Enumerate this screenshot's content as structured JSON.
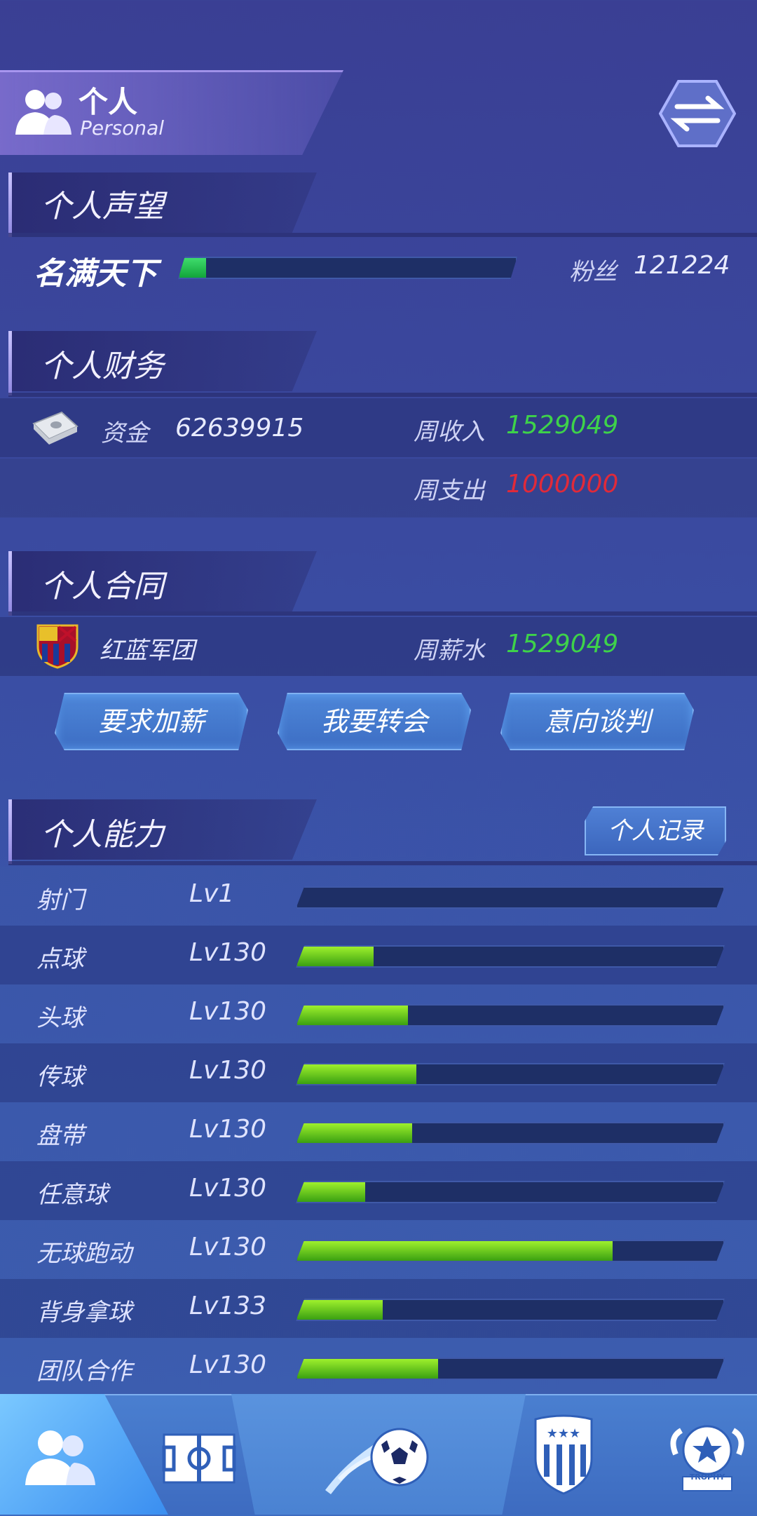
{
  "header": {
    "title": "个人",
    "subtitle": "Personal"
  },
  "reputation": {
    "section_title": "个人声望",
    "rank_title": "名满天下",
    "progress": 0.08,
    "fans_label": "粉丝",
    "fans_value": "121224"
  },
  "finance": {
    "section_title": "个人财务",
    "funds_label": "资金",
    "funds_value": "62639915",
    "weekly_income_label": "周收入",
    "weekly_income_value": "1529049",
    "weekly_expense_label": "周支出",
    "weekly_expense_value": "1000000"
  },
  "contract": {
    "section_title": "个人合同",
    "club_name": "红蓝军团",
    "weekly_salary_label": "周薪水",
    "weekly_salary_value": "1529049",
    "buttons": {
      "raise": "要求加薪",
      "transfer": "我要转会",
      "negotiate": "意向谈判"
    }
  },
  "ability": {
    "section_title": "个人能力",
    "records_button": "个人记录",
    "skills": [
      {
        "name": "射门",
        "level": "Lv1",
        "progress": 0.0
      },
      {
        "name": "点球",
        "level": "Lv130",
        "progress": 0.18
      },
      {
        "name": "头球",
        "level": "Lv130",
        "progress": 0.26
      },
      {
        "name": "传球",
        "level": "Lv130",
        "progress": 0.28
      },
      {
        "name": "盘带",
        "level": "Lv130",
        "progress": 0.27
      },
      {
        "name": "任意球",
        "level": "Lv130",
        "progress": 0.16
      },
      {
        "name": "无球跑动",
        "level": "Lv130",
        "progress": 0.74
      },
      {
        "name": "背身拿球",
        "level": "Lv133",
        "progress": 0.2
      },
      {
        "name": "团队合作",
        "level": "Lv130",
        "progress": 0.33
      }
    ]
  },
  "nav": {
    "items": [
      "personal-icon",
      "pitch-icon",
      "match-ball-icon",
      "club-badge-icon",
      "trophy-icon"
    ],
    "trophy_text": "TROPHY"
  },
  "colors": {
    "income": "#3ed24a",
    "expense": "#e02a3a",
    "accent": "#7fb2f2"
  }
}
